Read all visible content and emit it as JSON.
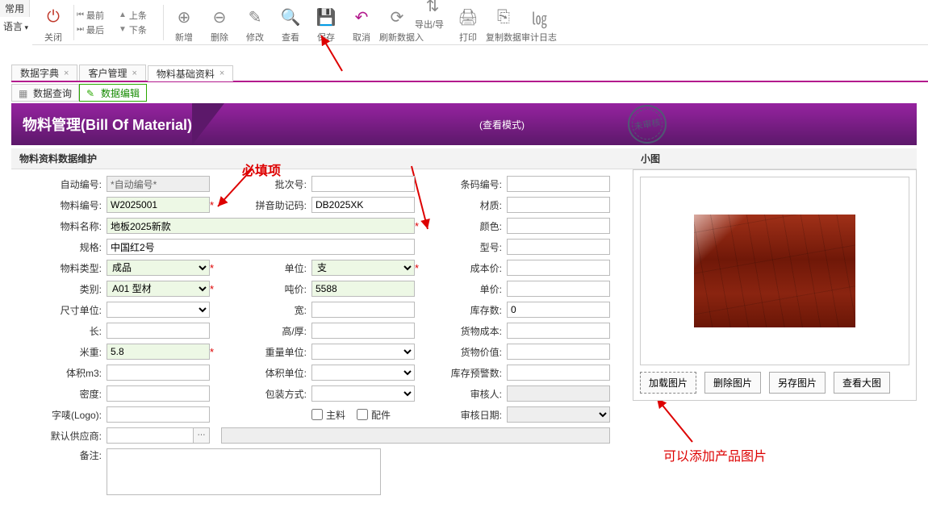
{
  "ribbon": {
    "tab": "常用",
    "lang": "语言"
  },
  "toolbar": {
    "close": "关闭",
    "nav": {
      "first": "最前",
      "prev": "上条",
      "last": "最后",
      "next": "下条"
    },
    "add": "新增",
    "del": "删除",
    "edit": "修改",
    "view": "查看",
    "save": "保存",
    "cancel": "取消",
    "refresh": "刷新数据",
    "export": "导出/导入",
    "print": "打印",
    "copy": "复制数据",
    "audit": "审计日志"
  },
  "doc_tabs": [
    {
      "label": "数据字典",
      "active": false,
      "closable": true
    },
    {
      "label": "客户管理",
      "active": false,
      "closable": true
    },
    {
      "label": "物料基础资料",
      "active": true,
      "closable": true
    }
  ],
  "sub_tabs": [
    {
      "label": "数据查询",
      "type": "grid"
    },
    {
      "label": "数据编辑",
      "type": "edit",
      "active": true
    }
  ],
  "header": {
    "title": "物料管理(Bill Of Material)",
    "mode": "(查看模式)",
    "stamp": "未审核"
  },
  "section_title": "物料资料数据维护",
  "annotations": {
    "required": "必填项",
    "image_hint": "可以添加产品图片"
  },
  "form": {
    "auto_no": {
      "label": "自动编号:",
      "value": "*自动编号*"
    },
    "batch": {
      "label": "批次号:",
      "value": ""
    },
    "barcode": {
      "label": "条码编号:",
      "value": ""
    },
    "mat_no": {
      "label": "物料编号:",
      "value": "W2025001"
    },
    "pinyin": {
      "label": "拼音助记码:",
      "value": "DB2025XK"
    },
    "material": {
      "label": "材质:",
      "value": ""
    },
    "mat_name": {
      "label": "物料名称:",
      "value": "地板2025新款"
    },
    "color": {
      "label": "颜色:",
      "value": ""
    },
    "spec": {
      "label": "规格:",
      "value": "中国红2号"
    },
    "model": {
      "label": "型号:",
      "value": ""
    },
    "mat_type": {
      "label": "物料类型:",
      "value": "成品"
    },
    "unit": {
      "label": "单位:",
      "value": "支"
    },
    "cost": {
      "label": "成本价:",
      "value": ""
    },
    "category": {
      "label": "类别:",
      "value": "A01 型材"
    },
    "ton_price": {
      "label": "吨价:",
      "value": "5588"
    },
    "price": {
      "label": "单价:",
      "value": ""
    },
    "dim_unit": {
      "label": "尺寸单位:",
      "value": ""
    },
    "width": {
      "label": "宽:",
      "value": ""
    },
    "stock": {
      "label": "库存数:",
      "value": "0"
    },
    "length": {
      "label": "长:",
      "value": ""
    },
    "height": {
      "label": "高/厚:",
      "value": ""
    },
    "goods_cost": {
      "label": "货物成本:",
      "value": ""
    },
    "meter_wt": {
      "label": "米重:",
      "value": "5.8"
    },
    "wt_unit": {
      "label": "重量单位:",
      "value": ""
    },
    "goods_val": {
      "label": "货物价值:",
      "value": ""
    },
    "volume": {
      "label": "体积m3:",
      "value": ""
    },
    "vol_unit": {
      "label": "体积单位:",
      "value": ""
    },
    "warn_qty": {
      "label": "库存预警数:",
      "value": ""
    },
    "density": {
      "label": "密度:",
      "value": ""
    },
    "pack": {
      "label": "包装方式:",
      "value": ""
    },
    "auditor": {
      "label": "审核人:",
      "value": ""
    },
    "logo": {
      "label": "字唛(Logo):",
      "value": ""
    },
    "main_mat": {
      "label": "主料"
    },
    "accessory": {
      "label": "配件"
    },
    "audit_date": {
      "label": "审核日期:",
      "value": ""
    },
    "def_supplier": {
      "label": "默认供应商:",
      "value": ""
    },
    "remarks": {
      "label": "备注:",
      "value": ""
    }
  },
  "image_panel": {
    "title": "小图",
    "buttons": {
      "load": "加载图片",
      "del": "删除图片",
      "save_as": "另存图片",
      "big": "查看大图"
    }
  }
}
